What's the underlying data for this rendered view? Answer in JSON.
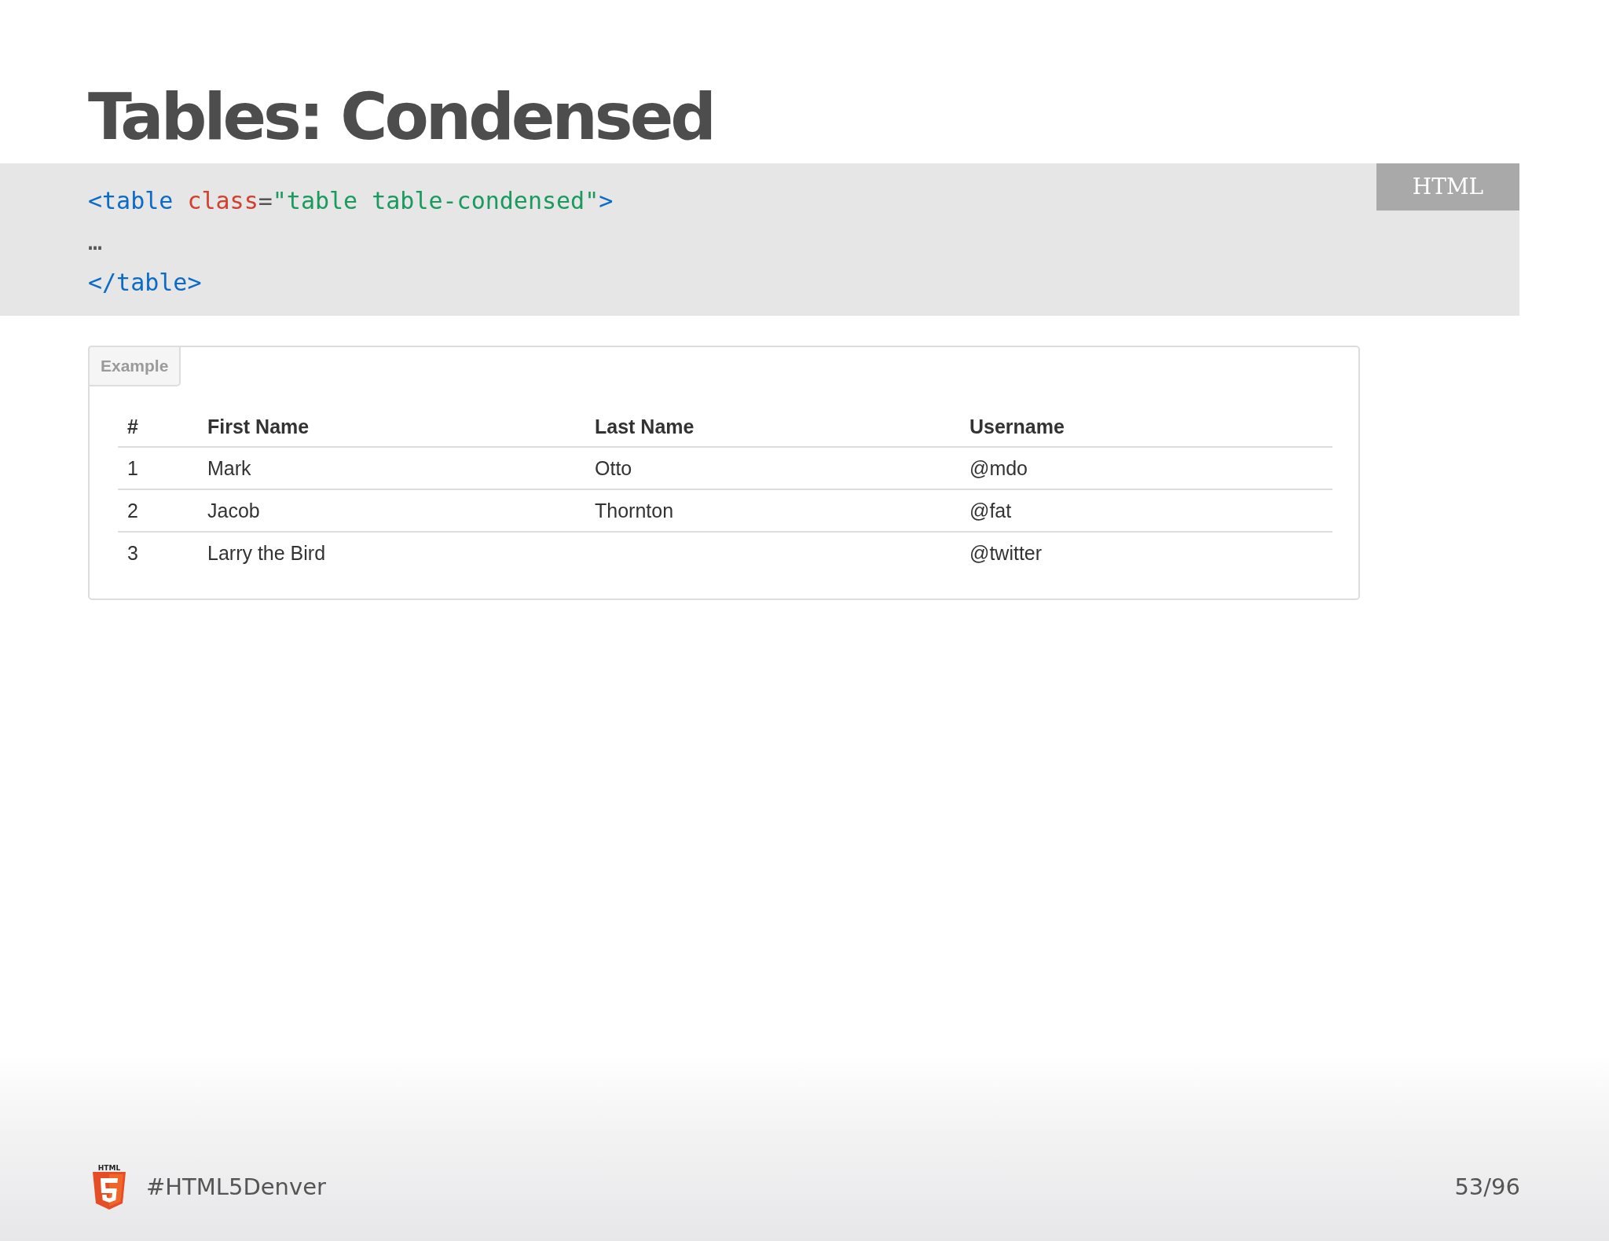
{
  "slide": {
    "title": "Tables: Condensed"
  },
  "code": {
    "language": "HTML",
    "lines": [
      {
        "tokens": [
          {
            "kind": "tag",
            "text": "<table"
          },
          {
            "kind": "attr",
            "text": " class"
          },
          {
            "kind": "plain",
            "text": "="
          },
          {
            "kind": "string",
            "text": "\"table table-condensed\""
          },
          {
            "kind": "tag",
            "text": ">"
          }
        ]
      },
      {
        "tokens": [
          {
            "kind": "plain",
            "text": "…"
          }
        ]
      },
      {
        "tokens": [
          {
            "kind": "tag",
            "text": "</table>"
          }
        ]
      }
    ]
  },
  "example": {
    "label": "Example",
    "table": {
      "columns": [
        "#",
        "First Name",
        "Last Name",
        "Username"
      ],
      "rows": [
        [
          "1",
          "Mark",
          "Otto",
          "@mdo"
        ],
        [
          "2",
          "Jacob",
          "Thornton",
          "@fat"
        ],
        [
          "3",
          "Larry the Bird",
          "",
          "@twitter"
        ]
      ]
    }
  },
  "footer": {
    "logo_label": "HTML",
    "hashtag": "#HTML5Denver",
    "page": "53/96"
  }
}
